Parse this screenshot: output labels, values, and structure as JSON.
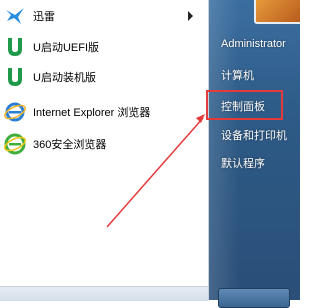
{
  "programs": [
    {
      "label": "迅雷",
      "icon": "xunlei-bird-icon",
      "has_submenu": true
    },
    {
      "label": "U启动UEFI版",
      "icon": "u-startup-icon",
      "has_submenu": false
    },
    {
      "label": "U启动装机版",
      "icon": "u-startup-icon",
      "has_submenu": false
    },
    {
      "label": "Internet Explorer 浏览器",
      "icon": "internet-explorer-icon",
      "has_submenu": false
    },
    {
      "label": "360安全浏览器",
      "icon": "360-browser-icon",
      "has_submenu": false
    }
  ],
  "right_pane": {
    "user": "Administrator",
    "items": [
      "计算机",
      "控制面板",
      "设备和打印机",
      "默认程序"
    ]
  },
  "annotation": {
    "highlight_color": "#e33a3a",
    "target": "控制面板"
  }
}
